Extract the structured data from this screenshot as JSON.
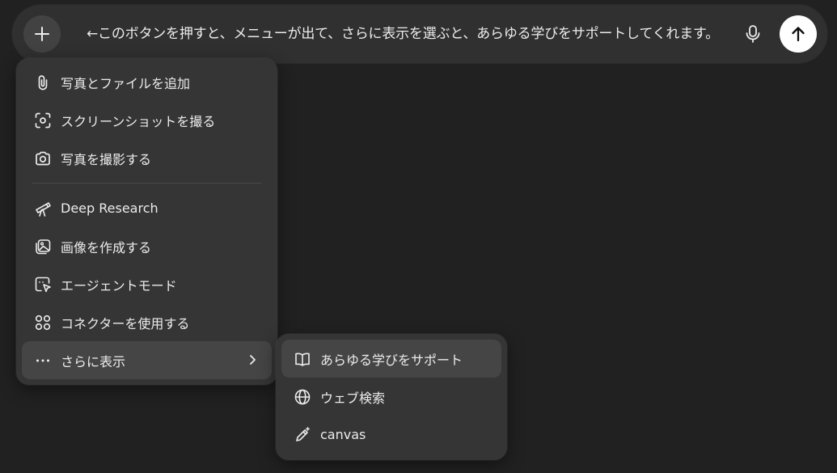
{
  "composer": {
    "text": "←このボタンを押すと、メニューが出て、さらに表示を選ぶと、あらゆる学びをサポートしてくれます。",
    "plus_icon": "plus-icon",
    "mic_icon": "microphone-icon",
    "send_icon": "arrow-up-icon"
  },
  "menu": {
    "items": [
      {
        "label": "写真とファイルを追加",
        "icon": "paperclip-icon"
      },
      {
        "label": "スクリーンショットを撮る",
        "icon": "screenshot-icon"
      },
      {
        "label": "写真を撮影する",
        "icon": "camera-icon"
      },
      {
        "label": "Deep Research",
        "icon": "telescope-icon"
      },
      {
        "label": "画像を作成する",
        "icon": "image-icon"
      },
      {
        "label": "エージェントモード",
        "icon": "agent-cursor-icon"
      },
      {
        "label": "コネクターを使用する",
        "icon": "connector-icon"
      },
      {
        "label": "さらに表示",
        "icon": "more-dots-icon"
      }
    ]
  },
  "submenu": {
    "items": [
      {
        "label": "あらゆる学びをサポート",
        "icon": "open-book-icon"
      },
      {
        "label": "ウェブ検索",
        "icon": "globe-icon"
      },
      {
        "label": "canvas",
        "icon": "pen-sparkle-icon"
      }
    ]
  },
  "colors": {
    "background": "#212121",
    "composer": "#303030",
    "menu": "#353535",
    "highlight": "#454545",
    "text": "#ececec",
    "send_button": "#ffffff"
  }
}
